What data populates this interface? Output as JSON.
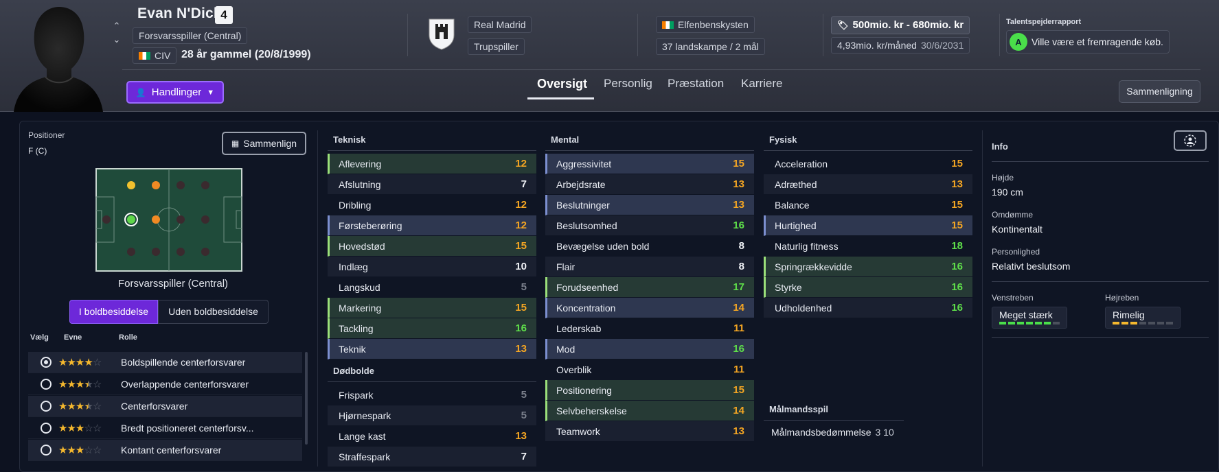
{
  "player": {
    "name": "Evan N'Dicka",
    "shirt_number": "4",
    "position": "Forsvarsspiller (Central)",
    "nationality_code": "CIV",
    "age_birth": "28 år gammel (20/8/1999)"
  },
  "header": {
    "actions_label": "Handlinger",
    "club": "Real Madrid",
    "squad_role": "Trupspiller",
    "country": "Elfenbenskysten",
    "caps": "37 landskampe / 2 mål",
    "value_range": "500mio. kr - 680mio. kr",
    "wage": "4,93mio. kr/måned",
    "contract_end": "30/6/2031",
    "scout_label": "Talentspejderrapport",
    "scout_grade": "A",
    "scout_text": "Ville være et fremragende køb.",
    "compare_label": "Sammenligning"
  },
  "tabs": [
    "Oversigt",
    "Personlig",
    "Præstation",
    "Karriere"
  ],
  "left_panel": {
    "title": "Positioner",
    "position_code": "F (C)",
    "compare_label": "Sammenlign",
    "pitch_caption": "Forsvarsspiller (Central)",
    "seg_in": "I boldbesiddelse",
    "seg_out": "Uden boldbesiddelse",
    "col_select": "Vælg",
    "col_ability": "Evne",
    "col_role": "Rolle",
    "roles": [
      {
        "name": "Boldspillende centerforsvarer",
        "stars": 4,
        "selected": true
      },
      {
        "name": "Overlappende centerforsvarer",
        "stars": 3.5,
        "selected": false
      },
      {
        "name": "Centerforsvarer",
        "stars": 3.5,
        "selected": false
      },
      {
        "name": "Bredt positioneret centerforsv...",
        "stars": 3,
        "selected": false
      },
      {
        "name": "Kontant centerforsvarer",
        "stars": 3,
        "selected": false
      }
    ]
  },
  "attributes": {
    "teknisk_title": "Teknisk",
    "teknisk": [
      {
        "name": "Aflevering",
        "value": "12"
      },
      {
        "name": "Afslutning",
        "value": "7"
      },
      {
        "name": "Dribling",
        "value": "12"
      },
      {
        "name": "Førsteberøring",
        "value": "12"
      },
      {
        "name": "Hovedstød",
        "value": "15"
      },
      {
        "name": "Indlæg",
        "value": "10"
      },
      {
        "name": "Langskud",
        "value": "5"
      },
      {
        "name": "Markering",
        "value": "15"
      },
      {
        "name": "Tackling",
        "value": "16"
      },
      {
        "name": "Teknik",
        "value": "13"
      }
    ],
    "dodbolde_title": "Dødbolde",
    "dodbolde": [
      {
        "name": "Frispark",
        "value": "5"
      },
      {
        "name": "Hjørnespark",
        "value": "5"
      },
      {
        "name": "Lange kast",
        "value": "13"
      },
      {
        "name": "Straffespark",
        "value": "7"
      }
    ],
    "mental_title": "Mental",
    "mental": [
      {
        "name": "Aggressivitet",
        "value": "15"
      },
      {
        "name": "Arbejdsrate",
        "value": "13"
      },
      {
        "name": "Beslutninger",
        "value": "13"
      },
      {
        "name": "Beslutsomhed",
        "value": "16"
      },
      {
        "name": "Bevægelse uden bold",
        "value": "8"
      },
      {
        "name": "Flair",
        "value": "8"
      },
      {
        "name": "Forudseenhed",
        "value": "17"
      },
      {
        "name": "Koncentration",
        "value": "14"
      },
      {
        "name": "Lederskab",
        "value": "11"
      },
      {
        "name": "Mod",
        "value": "16"
      },
      {
        "name": "Overblik",
        "value": "11"
      },
      {
        "name": "Positionering",
        "value": "15"
      },
      {
        "name": "Selvbeherskelse",
        "value": "14"
      },
      {
        "name": "Teamwork",
        "value": "13"
      }
    ],
    "fysisk_title": "Fysisk",
    "fysisk": [
      {
        "name": "Acceleration",
        "value": "15"
      },
      {
        "name": "Adræthed",
        "value": "13"
      },
      {
        "name": "Balance",
        "value": "15"
      },
      {
        "name": "Hurtighed",
        "value": "15"
      },
      {
        "name": "Naturlig fitness",
        "value": "18"
      },
      {
        "name": "Springrækkevidde",
        "value": "16"
      },
      {
        "name": "Styrke",
        "value": "16"
      },
      {
        "name": "Udholdenhed",
        "value": "16"
      }
    ],
    "gk_title": "Målmandsspil",
    "gk_label": "Målmandsbedømmelse",
    "gk_value": "3 10"
  },
  "info": {
    "title": "Info",
    "height_label": "Højde",
    "height": "190 cm",
    "rep_label": "Omdømme",
    "rep": "Kontinentalt",
    "pers_label": "Personlighed",
    "pers": "Relativt beslutsom",
    "left_foot_label": "Venstreben",
    "left_foot": "Meget stærk",
    "left_foot_level": 6,
    "right_foot_label": "Højreben",
    "right_foot": "Rimelig",
    "right_foot_level": 3
  },
  "colors": {
    "accent": "#6d28d9",
    "yellow": "#f5a623",
    "green": "#5fe04a"
  }
}
